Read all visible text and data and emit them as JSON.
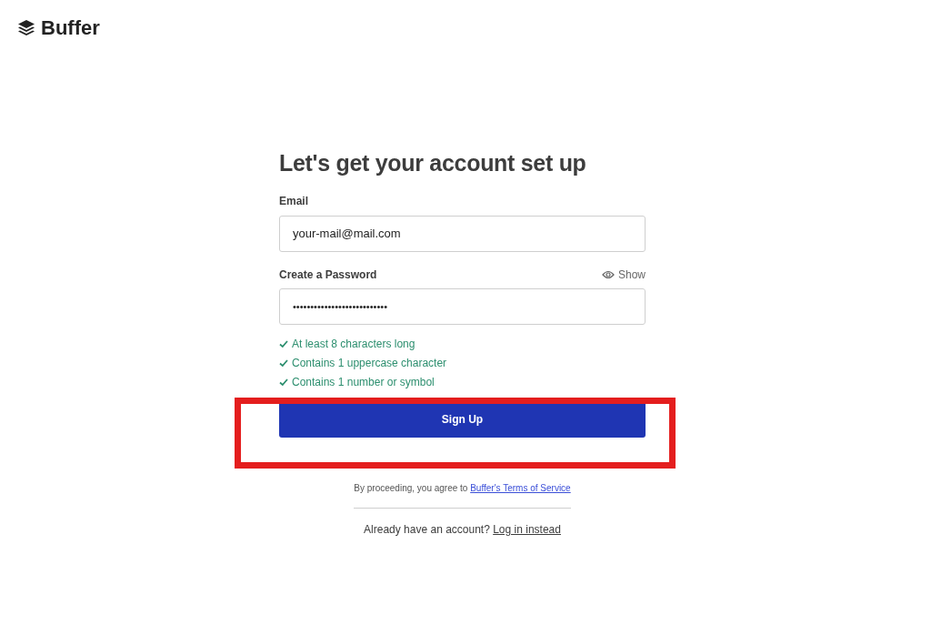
{
  "logo": {
    "text": "Buffer"
  },
  "title": "Let's get your account set up",
  "email": {
    "label": "Email",
    "value": "your-mail@mail.com"
  },
  "password": {
    "label": "Create a Password",
    "toggle": "Show",
    "masked_value": "•••••••••••••••••••••••••••"
  },
  "requirements": [
    {
      "text": "At least 8 characters long",
      "met": true
    },
    {
      "text": "Contains 1 uppercase character",
      "met": true
    },
    {
      "text": "Contains 1 number or symbol",
      "met": true
    }
  ],
  "sign_up_button": {
    "label": "Sign Up",
    "highlighted": true
  },
  "terms": {
    "text": "By proceeding, you agree to",
    "link": "Buffer's Terms of Service"
  },
  "login": {
    "text": "Already have an account?",
    "link": "Log in instead"
  }
}
